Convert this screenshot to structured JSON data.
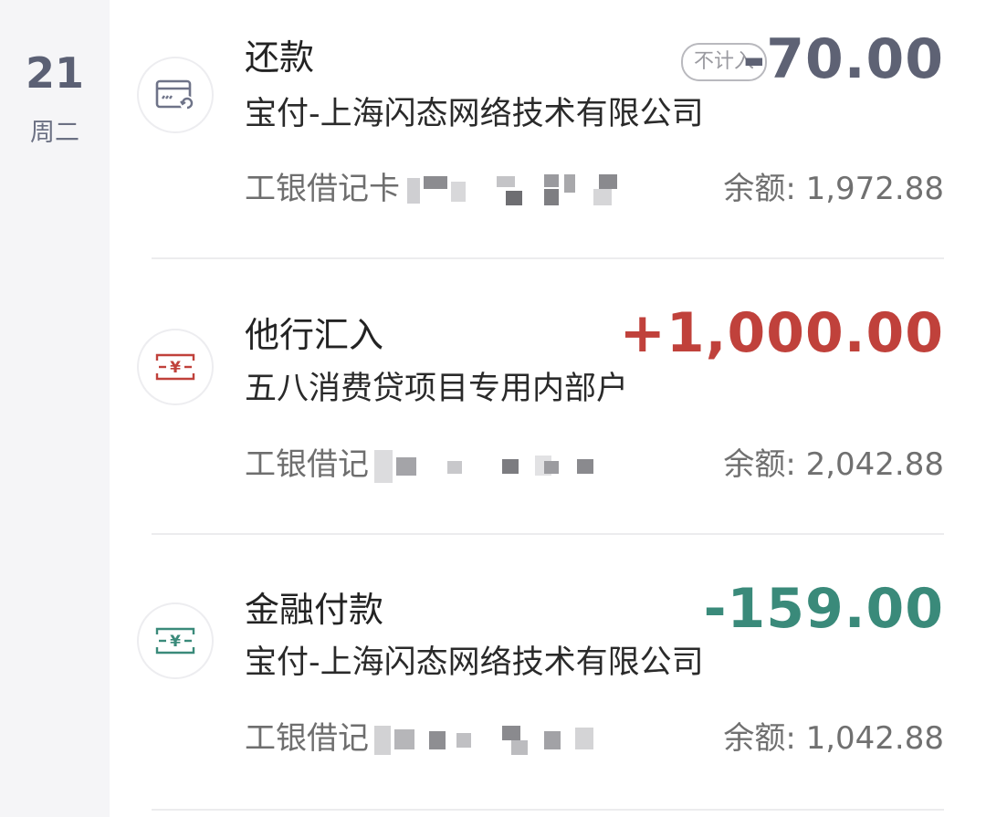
{
  "date": {
    "day": "21",
    "weekday": "周二"
  },
  "colors": {
    "expense_gray": "#5e6274",
    "income_red": "#c0413b",
    "expense_green": "#3a8a7a"
  },
  "transactions": [
    {
      "icon": "card-repay-icon",
      "title": "还款",
      "badge": "不计入",
      "amount": "-70.00",
      "amount_color": "#5e6274",
      "merchant": "宝付-上海闪态网络技术有限公司",
      "card_prefix": "工银借记卡",
      "balance": "余额: 1,972.88"
    },
    {
      "icon": "yuan-transfer-icon",
      "title": "他行汇入",
      "badge": "",
      "amount": "+1,000.00",
      "amount_color": "#c0413b",
      "merchant": "五八消费贷项目专用内部户",
      "card_prefix": "工银借记",
      "balance": "余额: 2,042.88"
    },
    {
      "icon": "yuan-transfer-icon",
      "title": "金融付款",
      "badge": "",
      "amount": "-159.00",
      "amount_color": "#3a8a7a",
      "merchant": "宝付-上海闪态网络技术有限公司",
      "card_prefix": "工银借记",
      "balance": "余额: 1,042.88"
    }
  ]
}
